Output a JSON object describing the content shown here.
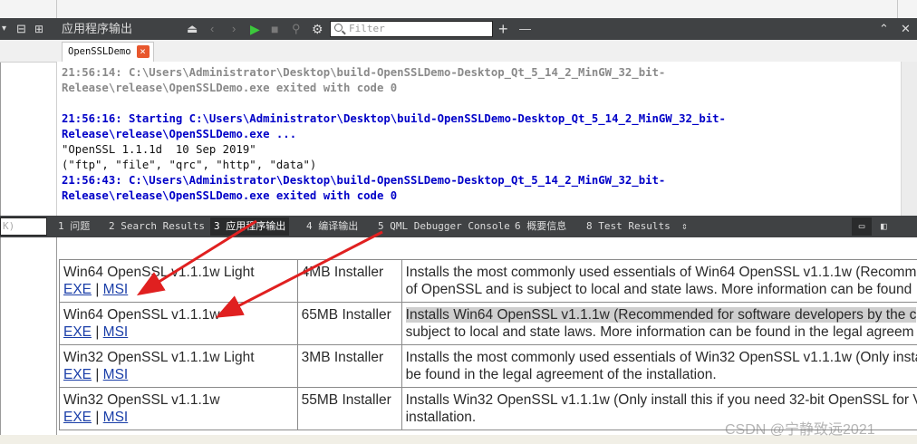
{
  "output_pane": {
    "title": "应用程序输出",
    "filter_placeholder": "Filter",
    "tab_label": "OpenSSLDemo",
    "close_label": "×",
    "log_lines": [
      {
        "text": "21:56:14: C:\\Users\\Administrator\\Desktop\\build-OpenSSLDemo-Desktop_Qt_5_14_2_MinGW_32_bit-",
        "color": "gray"
      },
      {
        "text": "Release\\release\\OpenSSLDemo.exe exited with code 0",
        "color": "gray"
      },
      {
        "text": "",
        "color": "black"
      },
      {
        "text": "21:56:16: Starting C:\\Users\\Administrator\\Desktop\\build-OpenSSLDemo-Desktop_Qt_5_14_2_MinGW_32_bit-",
        "color": "blue"
      },
      {
        "text": "Release\\release\\OpenSSLDemo.exe ...",
        "color": "blue"
      },
      {
        "text": "\"OpenSSL 1.1.1d  10 Sep 2019\"",
        "color": "black"
      },
      {
        "text": "(\"ftp\", \"file\", \"qrc\", \"http\", \"data\")",
        "color": "black"
      },
      {
        "text": "21:56:43: C:\\Users\\Administrator\\Desktop\\build-OpenSSLDemo-Desktop_Qt_5_14_2_MinGW_32_bit-",
        "color": "blue"
      },
      {
        "text": "Release\\release\\OpenSSLDemo.exe exited with code 0",
        "color": "blue"
      }
    ],
    "search_text": "K)",
    "panes": [
      {
        "label": "1 问题",
        "active": false
      },
      {
        "label": "2 Search Results",
        "active": false
      },
      {
        "label": "3 应用程序输出",
        "active": true
      },
      {
        "label": "4 编译输出",
        "active": false
      },
      {
        "label": "5 QML Debugger Console",
        "active": false
      },
      {
        "label": "6 概要信息",
        "active": false
      },
      {
        "label": "8 Test Results",
        "active": false
      }
    ]
  },
  "downloads": {
    "separator": "|",
    "rows": [
      {
        "name": "Win64 OpenSSL v1.1.1w Light",
        "exe": "EXE",
        "msi": "MSI",
        "size": "4MB Installer",
        "desc1": "Installs the most commonly used essentials of Win64 OpenSSL v1.1.1w (Recomme",
        "desc2": "of OpenSSL and is subject to local and state laws. More information can be found"
      },
      {
        "name": "Win64 OpenSSL v1.1.1w",
        "exe": "EXE",
        "msi": "MSI",
        "size": "65MB Installer",
        "desc1": "Installs Win64 OpenSSL v1.1.1w (Recommended for software developers by the c",
        "desc2": "subject to local and state laws. More information can be found in the legal agreem"
      },
      {
        "name": "Win32 OpenSSL v1.1.1w Light",
        "exe": "EXE",
        "msi": "MSI",
        "size": "3MB Installer",
        "desc1": "Installs the most commonly used essentials of Win32 OpenSSL v1.1.1w (Only insta",
        "desc2": "be found in the legal agreement of the installation."
      },
      {
        "name": "Win32 OpenSSL v1.1.1w",
        "exe": "EXE",
        "msi": "MSI",
        "size": "55MB Installer",
        "desc1": "Installs Win32 OpenSSL v1.1.1w (Only install this if you need 32-bit OpenSSL for V",
        "desc2": "installation."
      }
    ]
  },
  "watermark": "CSDN @宁静致远2021",
  "colors": {
    "arrow": "#e02020",
    "toolbar": "#404244",
    "link": "#1a3ea8",
    "highlight": "#cfcfcf"
  }
}
